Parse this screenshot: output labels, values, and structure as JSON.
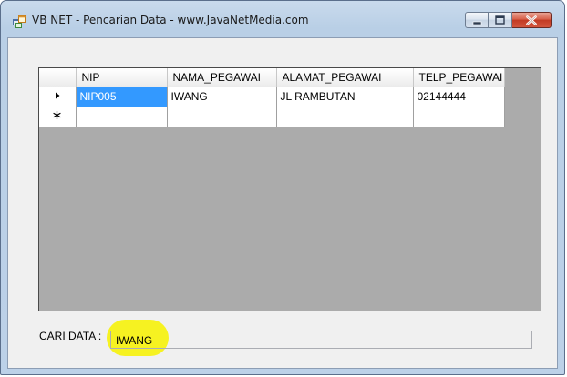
{
  "window": {
    "title": "VB NET - Pencarian Data - www.JavaNetMedia.com",
    "icon": "app-form-icon",
    "controls": [
      "minimize-icon",
      "maximize-icon",
      "close-icon"
    ]
  },
  "grid": {
    "columns": [
      "NIP",
      "NAMA_PEGAWAI",
      "ALAMAT_PEGAWAI",
      "TELP_PEGAWAI"
    ],
    "rows": [
      {
        "indicator": "current-row-arrow-icon",
        "cells": [
          "NIP005",
          "IWANG",
          "JL RAMBUTAN",
          "02144444"
        ],
        "selected_col": 0
      },
      {
        "indicator": "new-row-asterisk-icon",
        "cells": [
          "",
          "",
          "",
          ""
        ]
      }
    ],
    "selection_color": "#3399ff",
    "background_color": "#ababab"
  },
  "search": {
    "label": "CARI DATA :",
    "value": "IWANG",
    "highlight_color": "#f6f221"
  }
}
